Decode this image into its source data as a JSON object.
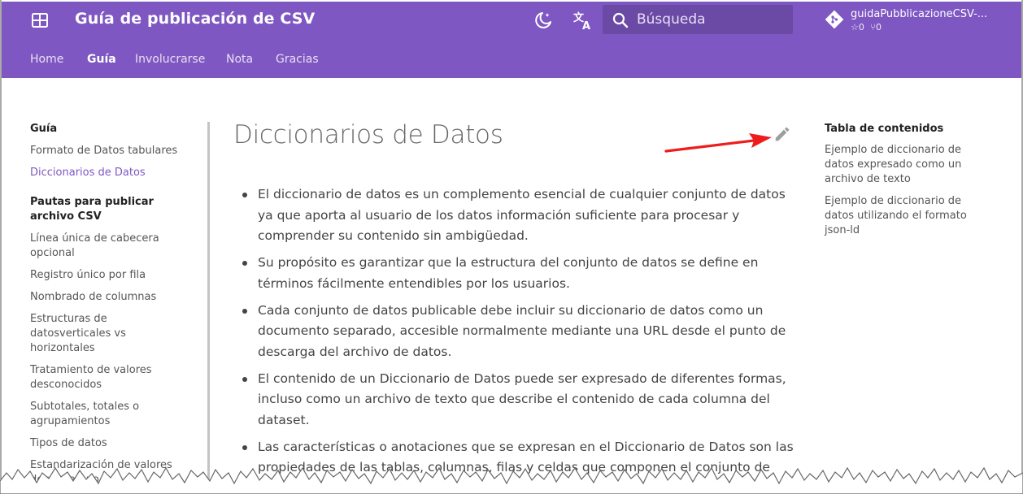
{
  "header": {
    "site_title": "Guía de publicación de CSV",
    "search_placeholder": "Búsqueda",
    "repo_name": "guidaPubblicazioneCSV-...",
    "repo_stars": "0",
    "repo_forks": "0",
    "icons": [
      "grid-icon",
      "theme-toggle-icon",
      "translate-icon",
      "search-icon",
      "git-icon"
    ]
  },
  "tabs": [
    {
      "label": "Home"
    },
    {
      "label": "Guía"
    },
    {
      "label": "Involucrarse"
    },
    {
      "label": "Nota"
    },
    {
      "label": "Gracias"
    }
  ],
  "sidebar": {
    "section1_title": "Guía",
    "section1_items": [
      "Formato de Datos tabulares",
      "Diccionarios de Datos"
    ],
    "section2_title": "Pautas para publicar archivo CSV",
    "section2_items": [
      "Línea única de cabecera opcional",
      "Registro único por fila",
      "Nombrado de columnas",
      "Estructuras de datosverticales vs horizontales",
      "Tratamiento de valores desconocidos",
      "Subtotales, totales o agrupamientos",
      "Tipos de datos",
      "Estandarización de valores de un campo"
    ]
  },
  "main": {
    "title": "Diccionarios de Datos",
    "bullets": [
      "El diccionario de datos es un complemento esencial de cualquier conjunto de datos ya que aporta al usuario de los datos información suficiente para procesar y comprender su contenido sin ambigüedad.",
      "Su propósito es garantizar que la estructura del conjunto de datos se define en términos fácilmente entendibles por los usuarios.",
      "Cada conjunto de datos publicable debe incluir su diccionario de datos como un documento separado, accesible normalmente mediante una URL desde el punto de descarga del archivo de datos.",
      "El contenido de un Diccionario de Datos puede ser expresado de diferentes formas, incluso como un archivo de texto que describe el contenido de cada columna del dataset.",
      "Las características o anotaciones que se expresan en el Diccionario de Datos son las propiedades de las tablas, columnas, filas y celdas que componen el conjunto de datos."
    ]
  },
  "toc": {
    "title": "Tabla de contenidos",
    "items": [
      "Ejemplo de diccionario de datos expresado como un archivo de texto",
      "Ejemplo de diccionario de datos utilizando el formato json-ld"
    ]
  },
  "colors": {
    "header_bg": "#7e57c2",
    "active_link": "#7e57c2",
    "annotation_arrow": "#ee1c1c"
  }
}
